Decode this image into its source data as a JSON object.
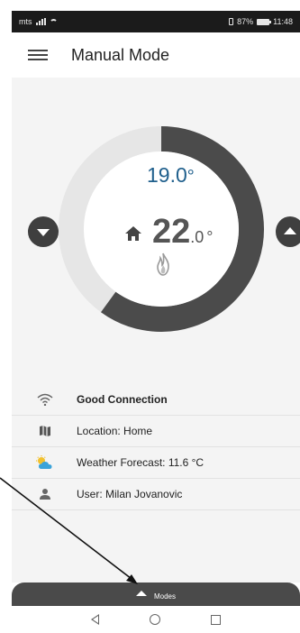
{
  "status_bar": {
    "carrier": "mts",
    "battery_percent": "87%",
    "time": "11:48"
  },
  "header": {
    "title": "Manual Mode",
    "menu_icon": "hamburger-menu-icon"
  },
  "thermostat": {
    "setpoint": "19.0",
    "setpoint_unit": "°",
    "current_whole": "22",
    "current_decimal": ".0",
    "current_unit": "°",
    "dial_fill_fraction": 0.6,
    "colors": {
      "active": "#4b4b4b",
      "inactive": "#e6e6e6",
      "setpoint": "#1f5f8c"
    },
    "decrease_icon": "chevron-down-icon",
    "increase_icon": "chevron-up-icon",
    "house_icon": "house-icon",
    "flame_icon": "flame-icon"
  },
  "info": [
    {
      "icon": "wifi-icon",
      "text": "Good Connection",
      "bold": true
    },
    {
      "icon": "map-icon",
      "text": "Location: Home",
      "bold": false
    },
    {
      "icon": "weather-partly-sunny-icon",
      "text": "Weather Forecast: 11.6 °C",
      "bold": false
    },
    {
      "icon": "user-icon",
      "text": "User: Milan Jovanovic",
      "bold": false
    }
  ],
  "modes_bar": {
    "label": "Modes"
  }
}
